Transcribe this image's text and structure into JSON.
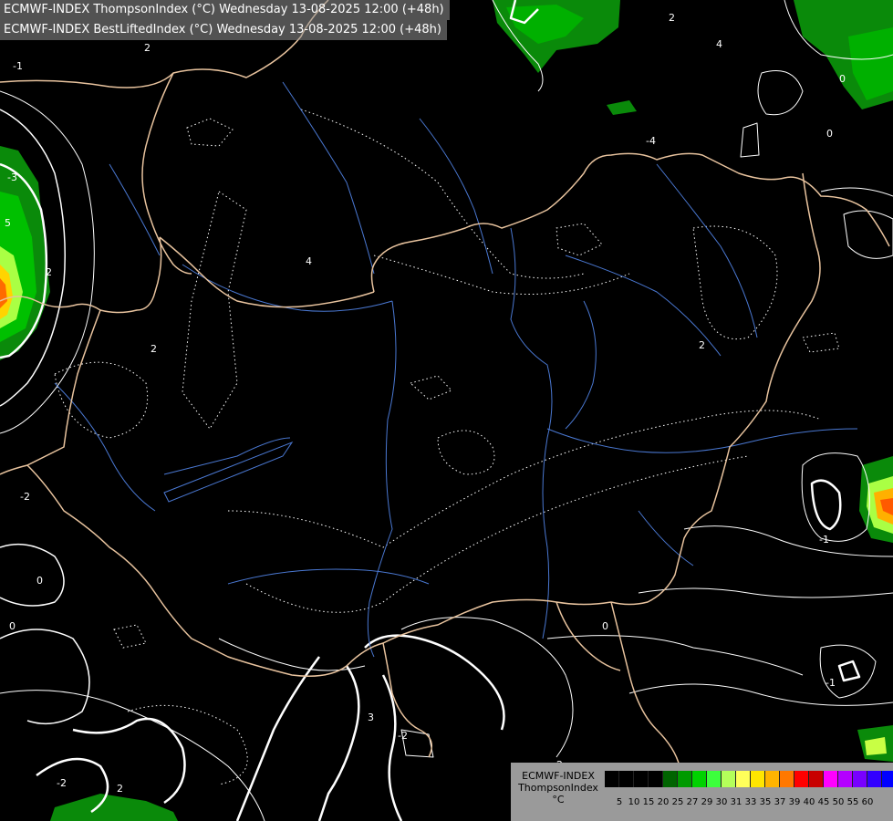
{
  "header": {
    "line1": "ECMWF-INDEX ThompsonIndex (°C) Wednesday 13-08-2025 12:00 (+48h)",
    "line2": "ECMWF-INDEX BestLiftedIndex (°C) Wednesday 13-08-2025 12:00 (+48h)"
  },
  "contour_labels": [
    "-1",
    "2",
    "-3",
    "5",
    "2",
    "2",
    "4",
    "2",
    "4",
    "-4",
    "0",
    "0",
    "2",
    "-2",
    "0",
    "0",
    "-1",
    "-2",
    "2",
    "3",
    "-2",
    "2",
    "0",
    "-1"
  ],
  "legend": {
    "title": [
      "ECMWF-INDEX",
      "ThompsonIndex",
      "°C"
    ],
    "ticks": [
      "5",
      "10",
      "15",
      "20",
      "25",
      "27",
      "29",
      "30",
      "31",
      "33",
      "35",
      "37",
      "39",
      "40",
      "45",
      "50",
      "55",
      "60"
    ],
    "colors": [
      "#000000",
      "#000000",
      "#000000",
      "#000000",
      "#006400",
      "#009a00",
      "#00d200",
      "#3cff3c",
      "#b4ff5a",
      "#ffff5a",
      "#ffe600",
      "#ffb400",
      "#ff7800",
      "#ff0000",
      "#c80000",
      "#ff00ff",
      "#b400ff",
      "#7800ff",
      "#3200ff",
      "#0000ff"
    ]
  },
  "colors": {
    "border": "#e8c39e",
    "river": "#4a78d2",
    "contour": "#ffffff"
  }
}
